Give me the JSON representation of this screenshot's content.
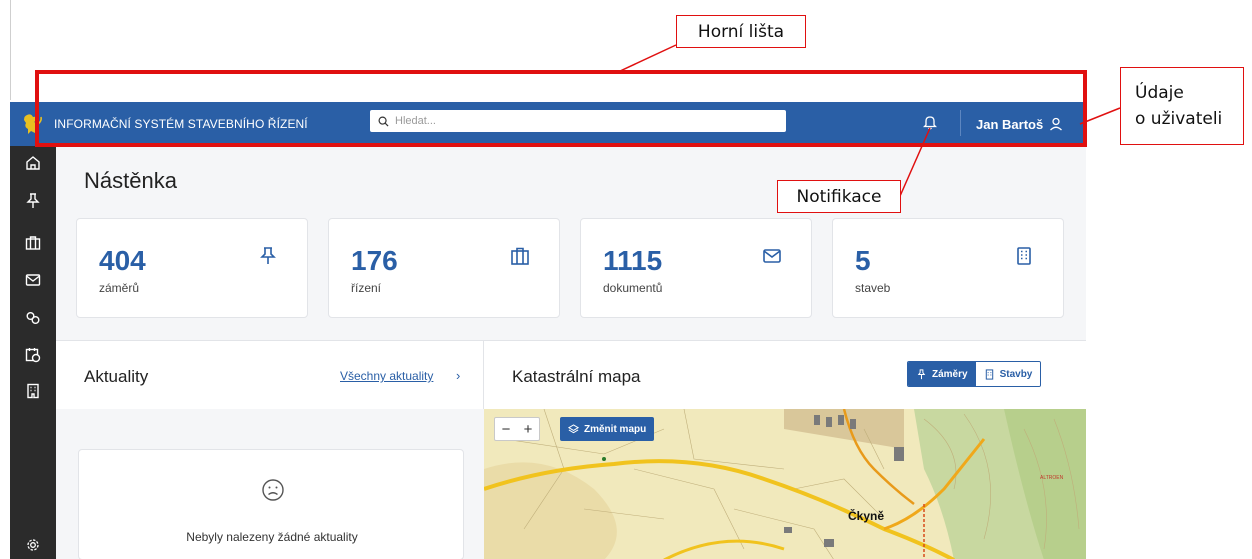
{
  "header": {
    "app_title": "INFORMAČNÍ SYSTÉM STAVEBNÍHO ŘÍZENÍ",
    "search_placeholder": "Hledat...",
    "user_name": "Jan Bartoš",
    "icons": [
      "lion-logo-icon",
      "search-icon",
      "bell-icon",
      "user-icon"
    ]
  },
  "sidebar": {
    "items": [
      {
        "icon": "home-icon"
      },
      {
        "icon": "pin-icon"
      },
      {
        "icon": "briefcase-icon"
      },
      {
        "icon": "mail-icon"
      },
      {
        "icon": "link-icon"
      },
      {
        "icon": "calendar-clock-icon"
      },
      {
        "icon": "building-icon"
      }
    ],
    "bottom_icon": "settings-icon"
  },
  "main": {
    "page_title": "Nástěnka",
    "stats": [
      {
        "value": "404",
        "label": "záměrů",
        "icon": "pin-icon"
      },
      {
        "value": "176",
        "label": "řízení",
        "icon": "briefcase-icon"
      },
      {
        "value": "1115",
        "label": "dokumentů",
        "icon": "mail-icon"
      },
      {
        "value": "5",
        "label": "staveb",
        "icon": "building-icon"
      }
    ],
    "news": {
      "title": "Aktuality",
      "all_link": "Všechny aktuality",
      "arrow": "›",
      "empty_text": "Nebyly nalezeny žádné aktuality"
    },
    "map": {
      "title": "Katastrální mapa",
      "toggle_on": "Záměry",
      "toggle_off": "Stavby",
      "zoom_out": "−",
      "zoom_in": "+",
      "change_map": "Změnit mapu",
      "town_label": "Čkyně"
    }
  },
  "annotations": {
    "top_bar": "Horní lišta",
    "user_info_line1": "Údaje",
    "user_info_line2": "o uživateli",
    "notifications": "Notifikace"
  },
  "colors": {
    "brand_blue": "#2a5fa6",
    "sidebar_dark": "#2b2b2b",
    "annotation_red": "#e01010",
    "logo_gold": "#e8c021"
  }
}
